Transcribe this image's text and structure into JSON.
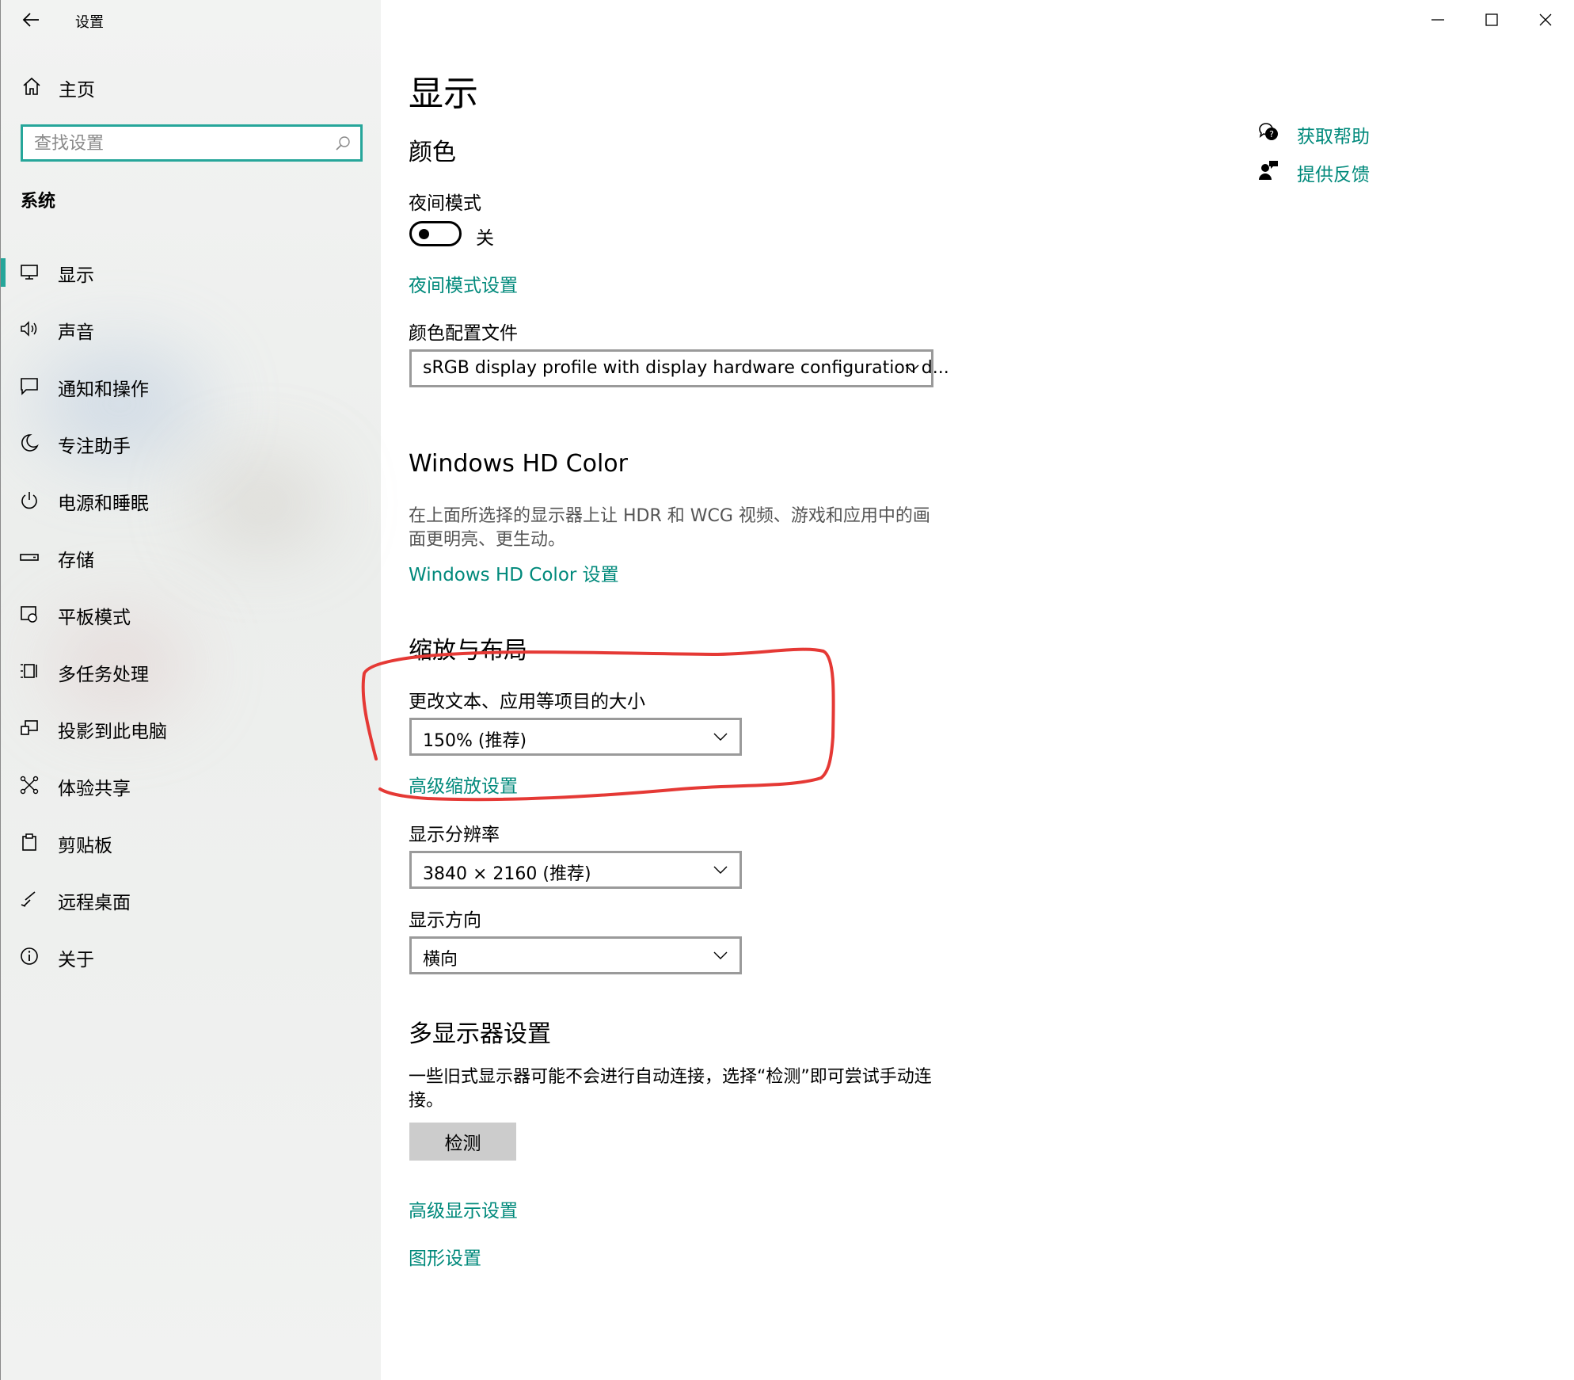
{
  "window": {
    "app_title": "设置",
    "controls": {
      "minimize": "minimize-icon",
      "maximize": "maximize-icon",
      "close": "close-icon"
    }
  },
  "sidebar": {
    "home_label": "主页",
    "search_placeholder": "查找设置",
    "section_label": "系统",
    "items": [
      {
        "label": "显示",
        "icon": "monitor-icon",
        "selected": true
      },
      {
        "label": "声音",
        "icon": "speaker-icon"
      },
      {
        "label": "通知和操作",
        "icon": "notification-icon"
      },
      {
        "label": "专注助手",
        "icon": "moon-icon"
      },
      {
        "label": "电源和睡眠",
        "icon": "power-icon"
      },
      {
        "label": "存储",
        "icon": "storage-icon"
      },
      {
        "label": "平板模式",
        "icon": "tablet-icon"
      },
      {
        "label": "多任务处理",
        "icon": "multitask-icon"
      },
      {
        "label": "投影到此电脑",
        "icon": "project-icon"
      },
      {
        "label": "体验共享",
        "icon": "share-icon"
      },
      {
        "label": "剪贴板",
        "icon": "clipboard-icon"
      },
      {
        "label": "远程桌面",
        "icon": "remote-desktop-icon"
      },
      {
        "label": "关于",
        "icon": "info-icon"
      }
    ]
  },
  "main": {
    "title": "显示",
    "color": {
      "heading": "颜色",
      "night_mode_label": "夜间模式",
      "night_mode_state": "关",
      "night_mode_settings_link": "夜间模式设置",
      "profile_label": "颜色配置文件",
      "profile_value": "sRGB display profile with display hardware configuration d..."
    },
    "hd_color": {
      "heading": "Windows HD Color",
      "description": "在上面所选择的显示器上让 HDR 和 WCG 视频、游戏和应用中的画面更明亮、更生动。",
      "link": "Windows HD Color 设置"
    },
    "scale": {
      "heading": "缩放与布局",
      "size_label": "更改文本、应用等项目的大小",
      "size_value": "150% (推荐)",
      "advanced_link": "高级缩放设置",
      "resolution_label": "显示分辨率",
      "resolution_value": "3840 × 2160 (推荐)",
      "orientation_label": "显示方向",
      "orientation_value": "横向"
    },
    "multi": {
      "heading": "多显示器设置",
      "description": "一些旧式显示器可能不会进行自动连接，选择“检测”即可尝试手动连接。",
      "detect_button": "检测",
      "advanced_display_link": "高级显示设置",
      "graphics_link": "图形设置"
    }
  },
  "help": {
    "get_help": "获取帮助",
    "feedback": "提供反馈"
  },
  "colors": {
    "accent": "#00897b",
    "search_border": "#26a69a",
    "annotation": "#e53935"
  }
}
